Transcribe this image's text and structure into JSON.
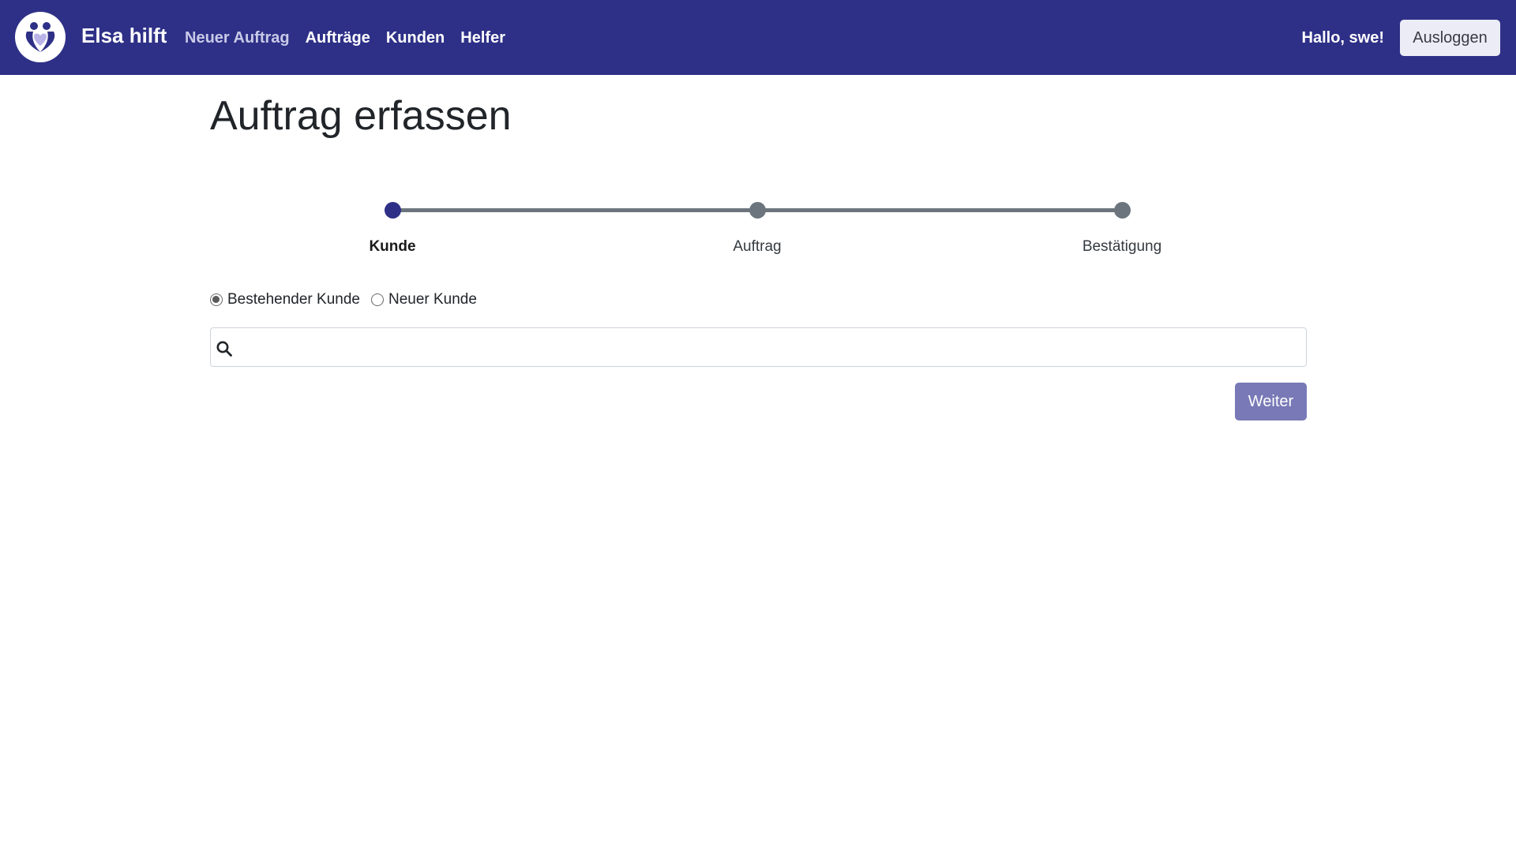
{
  "navbar": {
    "logo_icon": "heart-people-logo-icon",
    "brand": "Elsa hilft",
    "links": [
      {
        "label": "Neuer Auftrag",
        "active": true
      },
      {
        "label": "Aufträge",
        "active": false
      },
      {
        "label": "Kunden",
        "active": false
      },
      {
        "label": "Helfer",
        "active": false
      }
    ],
    "greeting": "Hallo, swe!",
    "logout_label": "Ausloggen"
  },
  "page": {
    "title": "Auftrag erfassen"
  },
  "stepper": {
    "steps": [
      {
        "label": "Kunde",
        "active": true
      },
      {
        "label": "Auftrag",
        "active": false
      },
      {
        "label": "Bestätigung",
        "active": false
      }
    ]
  },
  "customer_type": {
    "options": [
      {
        "label": "Bestehender Kunde",
        "checked": true
      },
      {
        "label": "Neuer Kunde",
        "checked": false
      }
    ]
  },
  "search": {
    "icon": "search-icon",
    "value": "",
    "placeholder": ""
  },
  "actions": {
    "next_label": "Weiter"
  },
  "colors": {
    "primary": "#2e3087",
    "nav_active_link": "#c9cae8",
    "stepper_inactive": "#6c757d",
    "next_button": "#7879b6",
    "logout_button": "#ececf6"
  }
}
